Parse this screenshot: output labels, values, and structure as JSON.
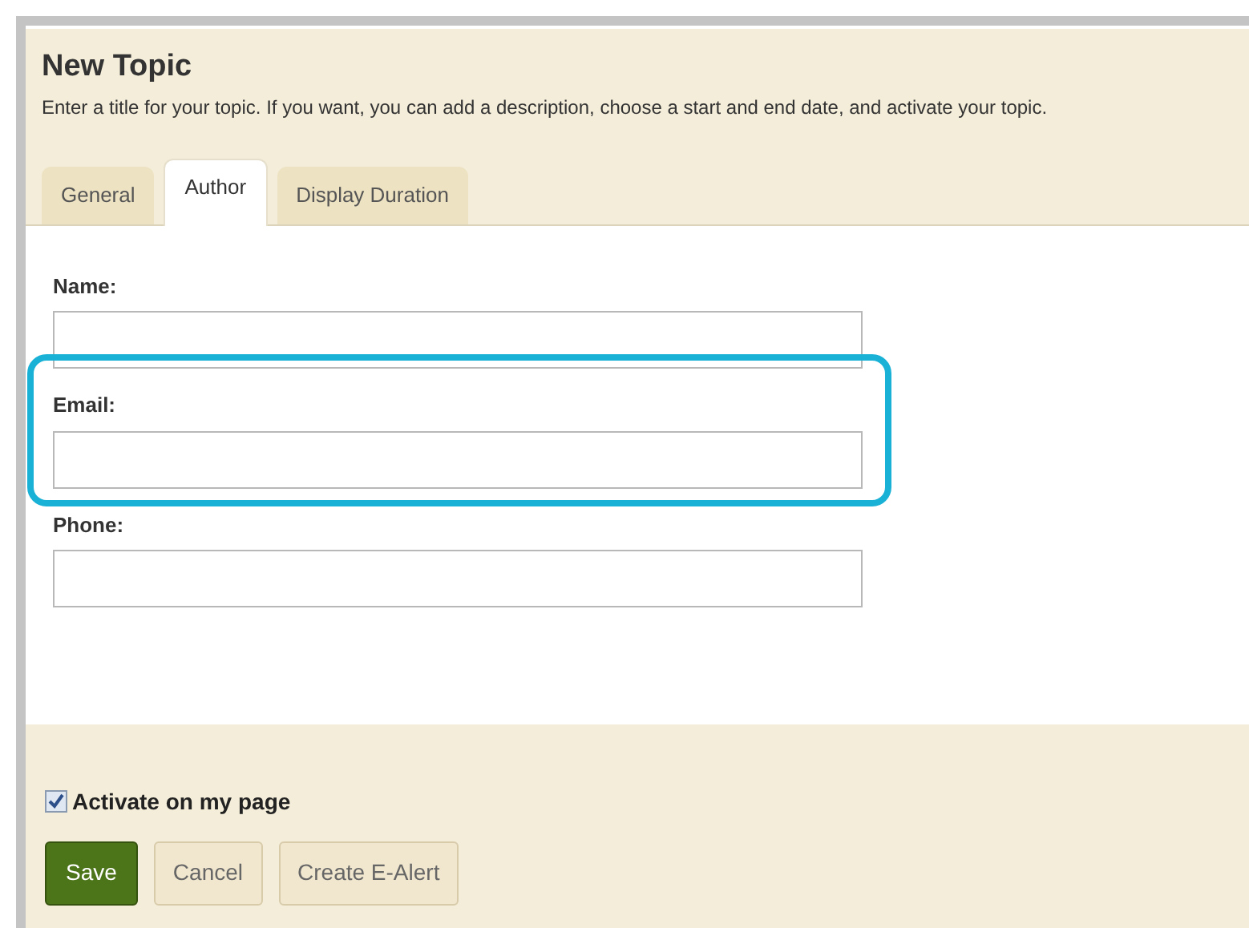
{
  "header": {
    "title": "New Topic",
    "description": "Enter a title for your topic. If you want, you can add a description, choose a start and end date, and activate your topic."
  },
  "tabs": [
    {
      "label": "General",
      "selected": false
    },
    {
      "label": "Author",
      "selected": true
    },
    {
      "label": "Display Duration",
      "selected": false
    }
  ],
  "fields": [
    {
      "label": "Name:",
      "highlighted": false
    },
    {
      "label": "Email:",
      "highlighted": true
    },
    {
      "label": "Phone:",
      "highlighted": false
    }
  ],
  "activate": {
    "label": "Activate on my page",
    "checked": true
  },
  "buttons": [
    {
      "label": "Save",
      "kind": "primary"
    },
    {
      "label": "Cancel",
      "kind": "secondary"
    },
    {
      "label": "Create E-Alert",
      "kind": "secondary"
    }
  ]
}
